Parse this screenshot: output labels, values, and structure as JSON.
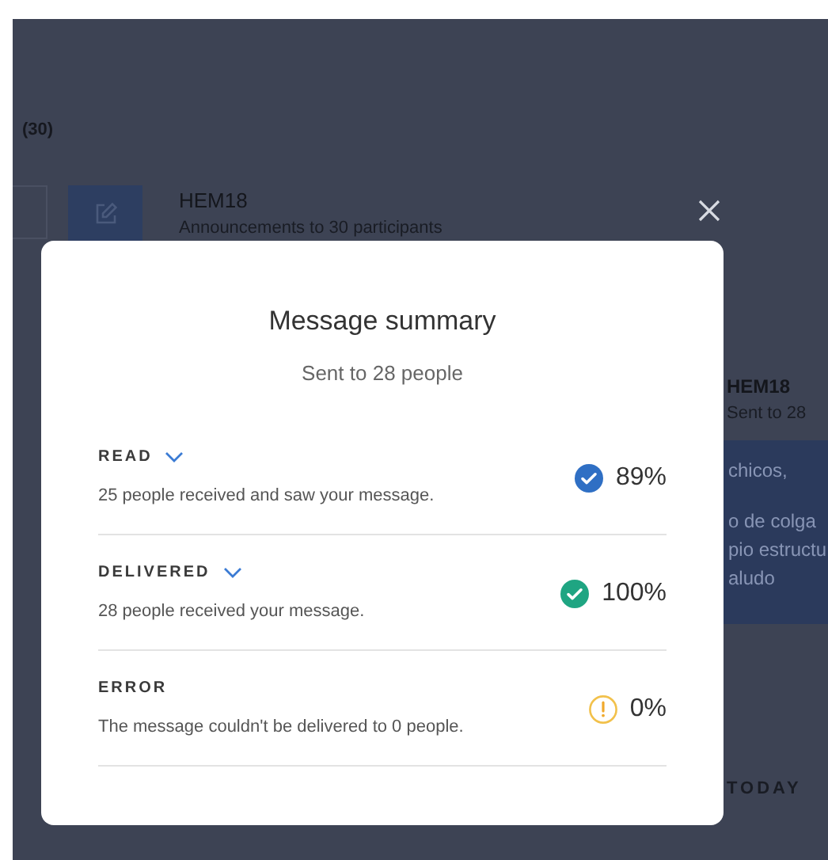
{
  "background": {
    "list_count": "(30)",
    "channel": {
      "name": "HEM18",
      "description": "Announcements to 30 participants"
    },
    "conversation": {
      "name": "HEM18",
      "subtitle": "Sent to 28",
      "paragraphs": [
        [
          "chicos,"
        ],
        [
          "o de colga",
          "pio estructu",
          "aludo"
        ]
      ]
    },
    "date_divider": "TODAY"
  },
  "modal": {
    "title": "Message summary",
    "subtitle": "Sent to 28 people",
    "rows": [
      {
        "kind": "read",
        "label": "READ",
        "expandable": true,
        "description": "25 people received and saw your message.",
        "percent": "89%"
      },
      {
        "kind": "delivered",
        "label": "DELIVERED",
        "expandable": true,
        "description": "28 people received your message.",
        "percent": "100%"
      },
      {
        "kind": "error",
        "label": "ERROR",
        "expandable": false,
        "description": "The message couldn't be delivered to 0 people.",
        "percent": "0%"
      }
    ]
  }
}
